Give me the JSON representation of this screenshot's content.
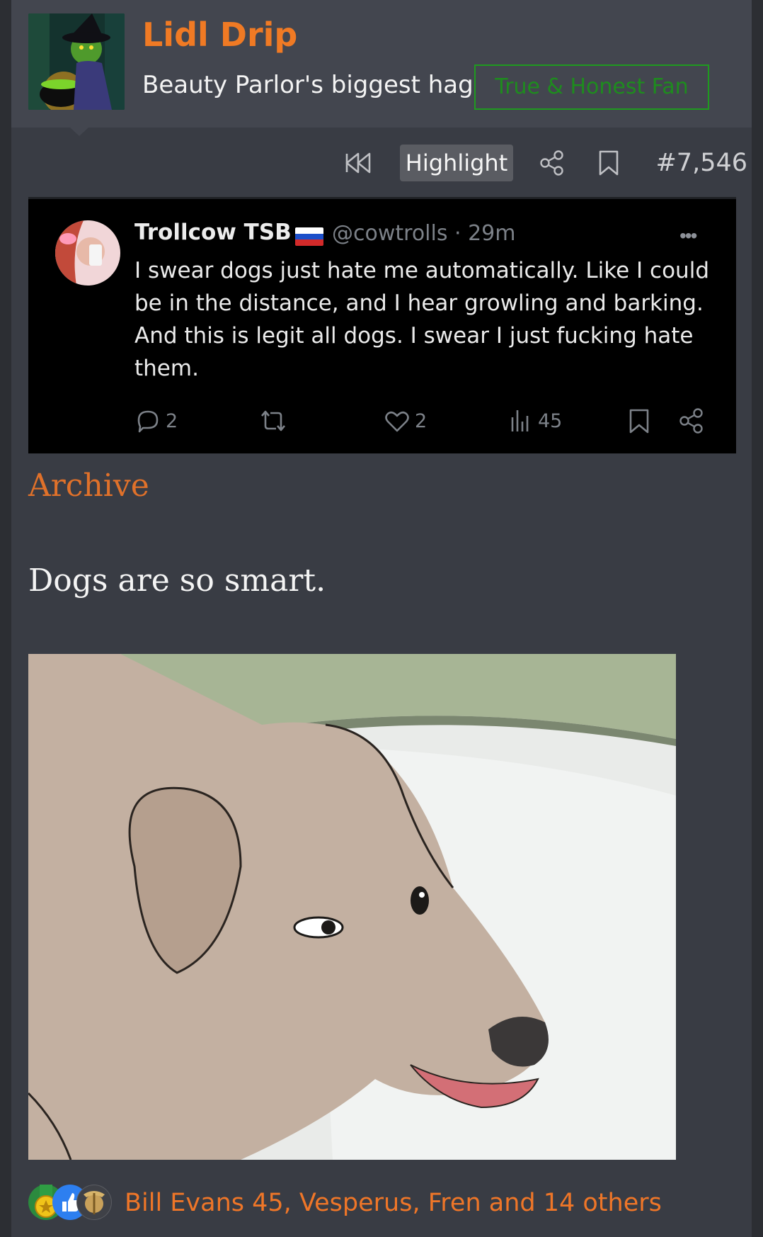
{
  "user": {
    "name": "Lidl Drip",
    "title": "Beauty Parlor's biggest hag",
    "banner": "True & Honest Fan"
  },
  "toolbar": {
    "highlight_label": "Highlight",
    "post_number": "#7,546"
  },
  "tweet": {
    "display_name": "Trollcow TSB",
    "handle_time": "@cowtrolls · 29m",
    "more": "•••",
    "text": "I swear dogs just hate me automatically. Like I could be in the distance, and I hear growling and barking. And this is legit all dogs. I swear I just fucking hate them.",
    "replies": "2",
    "likes": "2",
    "views": "45"
  },
  "post": {
    "archive_label": "Archive",
    "body": "Dogs are so smart."
  },
  "reactions": {
    "summary": "Bill Evans 45, Vesperus, Fren and 14 others"
  },
  "colors": {
    "accent": "#f07a24",
    "page_bg": "#2c2e33",
    "post_bg": "#393c44",
    "header_bg": "#43464f",
    "banner_green": "#1f9a1f"
  }
}
